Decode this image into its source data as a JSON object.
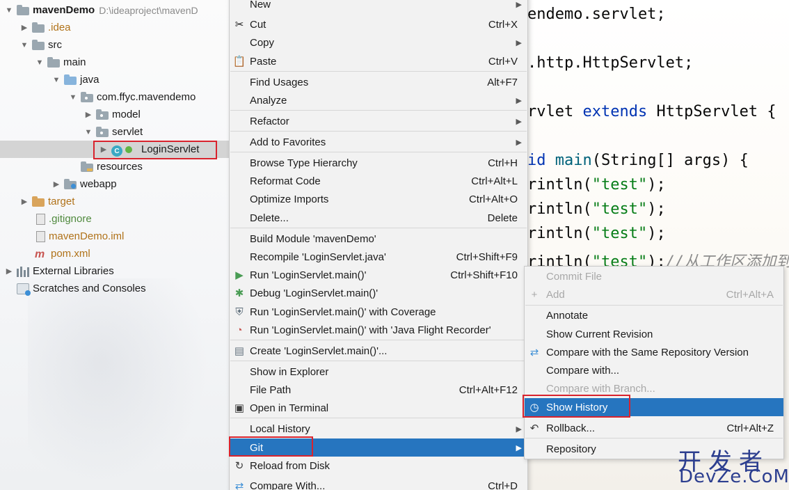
{
  "tree": {
    "items": [
      {
        "label": "mavenDemo",
        "path": "D:\\ideaproject\\mavenD"
      },
      {
        "label": ".idea"
      },
      {
        "label": "src"
      },
      {
        "label": "main"
      },
      {
        "label": "java"
      },
      {
        "label": "com.ffyc.mavendemo"
      },
      {
        "label": "model"
      },
      {
        "label": "servlet"
      },
      {
        "label": "LoginServlet"
      },
      {
        "label": "resources"
      },
      {
        "label": "webapp"
      },
      {
        "label": "target"
      },
      {
        "label": ".gitignore"
      },
      {
        "label": "mavenDemo.iml"
      },
      {
        "label": "pom.xml"
      },
      {
        "label": "External Libraries"
      },
      {
        "label": "Scratches and Consoles"
      }
    ]
  },
  "editor": {
    "lines": [
      {
        "a": "endemo.servlet;"
      },
      {
        "a": ".http.HttpServlet;"
      },
      {
        "a": "rvlet ",
        "kw": "extends",
        "b": " HttpServlet {"
      },
      {
        "kw": "id ",
        "fn": "main",
        "b": "(String[] args) {"
      },
      {
        "a": "rintln(",
        "str": "\"test\"",
        "b": ");"
      },
      {
        "a": "rintln(",
        "str": "\"test\"",
        "b": ");"
      },
      {
        "a": "rintln(",
        "str": "\"test\"",
        "b": ");"
      },
      {
        "a": "rintln(",
        "str": "\"test\"",
        "b": ");",
        "cm": "//从工作区添加到"
      }
    ]
  },
  "context_menu": {
    "items": [
      {
        "label": "New",
        "shortcut": ""
      },
      {
        "label": "Cut",
        "shortcut": "Ctrl+X"
      },
      {
        "label": "Copy",
        "shortcut": ""
      },
      {
        "label": "Paste",
        "shortcut": "Ctrl+V"
      },
      {
        "label": "Find Usages",
        "shortcut": "Alt+F7"
      },
      {
        "label": "Analyze",
        "shortcut": ""
      },
      {
        "label": "Refactor",
        "shortcut": ""
      },
      {
        "label": "Add to Favorites",
        "shortcut": ""
      },
      {
        "label": "Browse Type Hierarchy",
        "shortcut": "Ctrl+H"
      },
      {
        "label": "Reformat Code",
        "shortcut": "Ctrl+Alt+L"
      },
      {
        "label": "Optimize Imports",
        "shortcut": "Ctrl+Alt+O"
      },
      {
        "label": "Delete...",
        "shortcut": "Delete"
      },
      {
        "label": "Build Module 'mavenDemo'",
        "shortcut": ""
      },
      {
        "label": "Recompile 'LoginServlet.java'",
        "shortcut": "Ctrl+Shift+F9"
      },
      {
        "label": "Run 'LoginServlet.main()'",
        "shortcut": "Ctrl+Shift+F10"
      },
      {
        "label": "Debug 'LoginServlet.main()'",
        "shortcut": ""
      },
      {
        "label": "Run 'LoginServlet.main()' with Coverage",
        "shortcut": ""
      },
      {
        "label": "Run 'LoginServlet.main()' with 'Java Flight Recorder'",
        "shortcut": ""
      },
      {
        "label": "Create 'LoginServlet.main()'...",
        "shortcut": ""
      },
      {
        "label": "Show in Explorer",
        "shortcut": ""
      },
      {
        "label": "File Path",
        "shortcut": "Ctrl+Alt+F12"
      },
      {
        "label": "Open in Terminal",
        "shortcut": ""
      },
      {
        "label": "Local History",
        "shortcut": ""
      },
      {
        "label": "Git",
        "shortcut": ""
      },
      {
        "label": "Reload from Disk",
        "shortcut": ""
      },
      {
        "label": "Compare With...",
        "shortcut": "Ctrl+D"
      }
    ]
  },
  "git_menu": {
    "items": [
      {
        "label": "Commit File",
        "shortcut": ""
      },
      {
        "label": "Add",
        "shortcut": "Ctrl+Alt+A"
      },
      {
        "label": "Annotate",
        "shortcut": ""
      },
      {
        "label": "Show Current Revision",
        "shortcut": ""
      },
      {
        "label": "Compare with the Same Repository Version",
        "shortcut": ""
      },
      {
        "label": "Compare with...",
        "shortcut": ""
      },
      {
        "label": "Compare with Branch...",
        "shortcut": ""
      },
      {
        "label": "Show History",
        "shortcut": ""
      },
      {
        "label": "Rollback...",
        "shortcut": "Ctrl+Alt+Z"
      },
      {
        "label": "Repository",
        "shortcut": ""
      }
    ]
  },
  "watermark": {
    "zh": "开发者",
    "en": "DevZe.CoM"
  },
  "colors": {
    "selection": "#2675bf",
    "highlight_box": "#d9232d",
    "menu_bg": "#f2f2f2"
  }
}
